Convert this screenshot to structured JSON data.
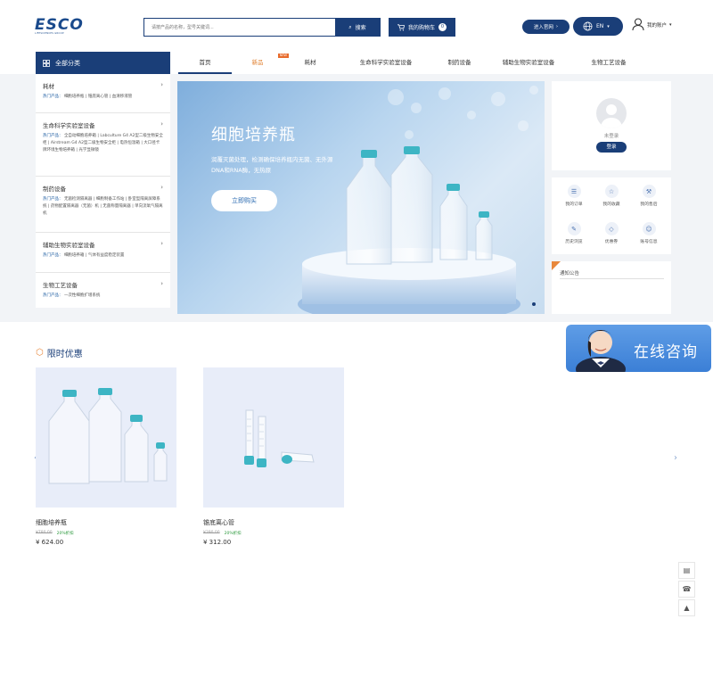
{
  "header": {
    "logo": "ESCO",
    "logo_sub": "LIFESCIENCES GROUP",
    "search_placeholder": "请按产品的名称，型号关键词...",
    "search_label": "搜索",
    "cart_label": "我的购物车",
    "cart_count": "0",
    "official_site_label": "进入官网",
    "lang_label": "EN",
    "account_label": "我的账户"
  },
  "nav": {
    "all_categories": "全部分类",
    "items": [
      {
        "label": "首页",
        "active": true
      },
      {
        "label": "新品",
        "new": true,
        "badge": "NEW"
      },
      {
        "label": "耗材"
      },
      {
        "label": "生命科学实验室设备"
      },
      {
        "label": "制药设备"
      },
      {
        "label": "辅助生物实验室设备"
      },
      {
        "label": "生物工艺设备"
      }
    ]
  },
  "sidebar": {
    "hot_prefix": "热门产品：",
    "categories": [
      {
        "title": "耗材",
        "subs": [
          "细胞培养瓶",
          "锥底离心管",
          "血清移液管"
        ]
      },
      {
        "title": "生命科学实验室设备",
        "subs": [
          "全自动细胞培养箱",
          "Labculture G4 A2型二级生物安全柜",
          "Airstream G4 A2型二级生物安全柜",
          "电热恒温箱",
          "大口径卡牌环境生物培养箱",
          "光学显微镜"
        ]
      },
      {
        "title": "制药设备",
        "subs": [
          "无菌检测隔离器",
          "细胞制备工作站",
          "卧室型隔离屏障系统",
          "药物配置隔离器（无菌）机",
          "无菌称量隔离器",
          "单向流氧气隔离机"
        ]
      },
      {
        "title": "辅助生物实验室设备",
        "subs": [
          "细胞培养箱",
          "气体有益度稳定装置"
        ]
      },
      {
        "title": "生物工艺设备",
        "subs": [
          "一次性细胞扩增系统"
        ]
      }
    ]
  },
  "banner": {
    "title": "细胞培养瓶",
    "desc": "润覆灭菌处理，检测确保培养瓶内无菌、无外源DNA和RNA酶，无热原",
    "button": "立即购买"
  },
  "user": {
    "status": "未登录",
    "login": "登录",
    "quick_links": [
      {
        "label": "我的订单",
        "icon": "order-icon"
      },
      {
        "label": "我的收藏",
        "icon": "star-icon"
      },
      {
        "label": "我的售后",
        "icon": "after-sales-icon"
      },
      {
        "label": "历史浏览",
        "icon": "history-icon"
      },
      {
        "label": "优惠券",
        "icon": "coupon-icon"
      },
      {
        "label": "账号信息",
        "icon": "account-info-icon"
      }
    ]
  },
  "notice": {
    "title": "通知公告"
  },
  "consult": {
    "label": "在线咨询"
  },
  "promo": {
    "title": "限时优惠",
    "products": [
      {
        "name": "细胞培养瓶",
        "original_price": "¥780.00",
        "discount": "20%折扣",
        "price": "¥ 624.00"
      },
      {
        "name": "锥底离心管",
        "original_price": "¥390.00",
        "discount": "20%折扣",
        "price": "¥ 312.00"
      }
    ]
  },
  "colors": {
    "primary": "#1a3e78",
    "accent": "#e8883c",
    "discount": "#2e9a3f",
    "page_band": "#f2f4f7"
  }
}
